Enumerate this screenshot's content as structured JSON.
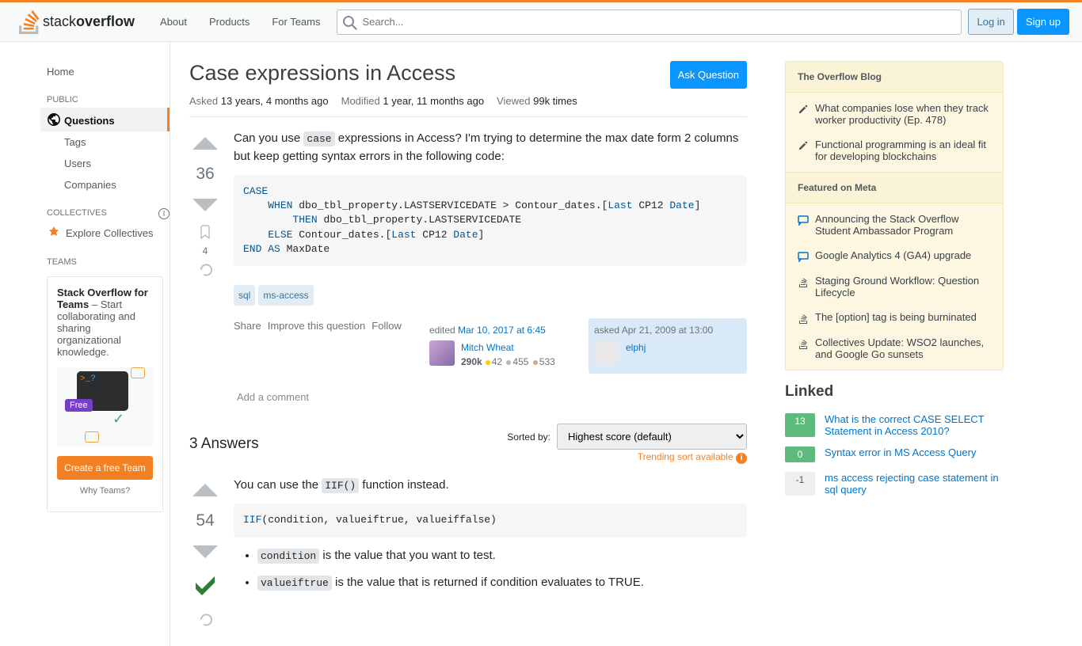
{
  "topbar": {
    "nav": [
      "About",
      "Products",
      "For Teams"
    ],
    "search_placeholder": "Search...",
    "login": "Log in",
    "signup": "Sign up"
  },
  "leftnav": {
    "home": "Home",
    "public": "PUBLIC",
    "questions": "Questions",
    "tags": "Tags",
    "users": "Users",
    "companies": "Companies",
    "collectives": "COLLECTIVES",
    "explore": "Explore Collectives",
    "teams": "TEAMS",
    "teams_box": {
      "title": "Stack Overflow for Teams",
      "body": " – Start collaborating and sharing organizational knowledge.",
      "free": "Free",
      "create": "Create a free Team",
      "why": "Why Teams?"
    }
  },
  "question": {
    "title": "Case expressions in Access",
    "ask": "Ask Question",
    "meta": {
      "asked_label": "Asked",
      "asked": "13 years, 4 months ago",
      "modified_label": "Modified",
      "modified": "1 year, 11 months ago",
      "viewed_label": "Viewed",
      "viewed": "99k times"
    },
    "score": "36",
    "bookmark": "4",
    "body_pre": "Can you use ",
    "body_code": "case",
    "body_post": " expressions in Access? I'm trying to determine the max date form 2 columns but keep getting syntax errors in the following code:",
    "tags": [
      "sql",
      "ms-access"
    ],
    "actions": {
      "share": "Share",
      "improve": "Improve this question",
      "follow": "Follow"
    },
    "editor": {
      "prefix": "edited",
      "time": "Mar 10, 2017 at 6:45",
      "name": "Mitch Wheat",
      "rep": "290k",
      "gold": "42",
      "silver": "455",
      "bronze": "533"
    },
    "asker": {
      "prefix": "asked",
      "time": "Apr 21, 2009 at 13:00",
      "name": "elphj"
    },
    "add_comment": "Add a comment"
  },
  "answers": {
    "count": "3 Answers",
    "sorted_by": "Sorted by:",
    "trending": "Trending sort available",
    "sort_option": "Highest score (default)",
    "a1": {
      "score": "54",
      "body_pre": "You can use the ",
      "body_code": "IIF()",
      "body_post": " function instead.",
      "bullet1_code": "condition",
      "bullet1_text": " is the value that you want to test.",
      "bullet2_code": "valueiftrue",
      "bullet2_text": " is the value that is returned if condition evaluates to TRUE."
    }
  },
  "sidebar": {
    "blog_heading": "The Overflow Blog",
    "blog": [
      "What companies lose when they track worker productivity (Ep. 478)",
      "Functional programming is an ideal fit for developing blockchains"
    ],
    "meta_heading": "Featured on Meta",
    "meta": [
      "Announcing the Stack Overflow Student Ambassador Program",
      "Google Analytics 4 (GA4) upgrade",
      "Staging Ground Workflow: Question Lifecycle",
      "The [option] tag is being burninated",
      "Collectives Update: WSO2 launches, and Google Go sunsets"
    ],
    "linked_heading": "Linked",
    "linked": [
      {
        "score": "13",
        "cls": "answered",
        "title": "What is the correct CASE SELECT Statement in Access 2010?"
      },
      {
        "score": "0",
        "cls": "zero",
        "title": "Syntax error in MS Access Query"
      },
      {
        "score": "-1",
        "cls": "neg",
        "title": "ms access rejecting case statement in sql query"
      }
    ]
  }
}
